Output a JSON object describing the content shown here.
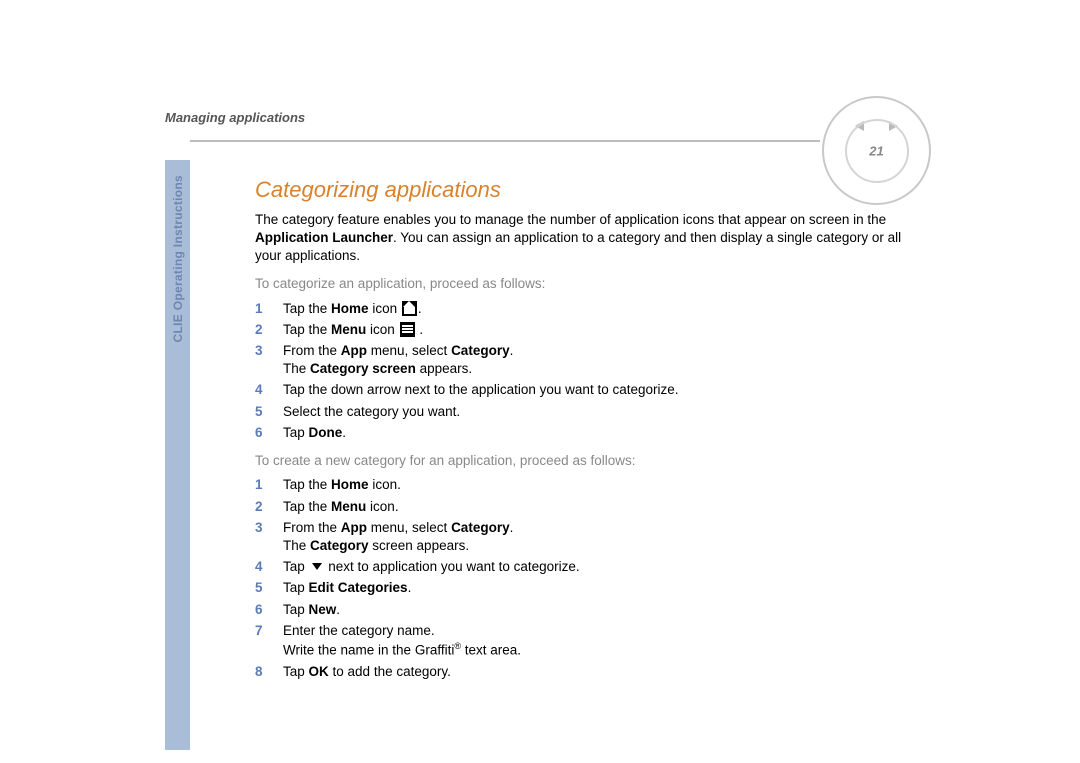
{
  "chapter": "Managing applications",
  "sidebar_label": "CLIE Operating Instructions",
  "page_number": "21",
  "title": "Categorizing applications",
  "intro_p1a": "The category feature enables you to manage the number of application icons that appear on screen in the ",
  "intro_b1": "Application Launcher",
  "intro_p1b": ". You can assign an application to a category and then display a single category or all your applications.",
  "proc1_lead": "To categorize an application, proceed as follows:",
  "s1": {
    "a": "Tap the ",
    "b": "Home",
    "c": " icon ",
    "d": "."
  },
  "s2": {
    "a": "Tap the ",
    "b": "Menu",
    "c": " icon ",
    "d": " ."
  },
  "s3": {
    "a": "From the ",
    "b": "App",
    "c": " menu, select ",
    "d": "Category",
    "e": ".",
    "f": "The ",
    "g": "Category screen",
    "h": " appears."
  },
  "s4": "Tap the down arrow next to the application you want to categorize.",
  "s5": "Select the category you want.",
  "s6": {
    "a": "Tap ",
    "b": "Done",
    "c": "."
  },
  "proc2_lead": "To create a new category for an application, proceed as follows:",
  "t1": {
    "a": "Tap the ",
    "b": "Home",
    "c": " icon."
  },
  "t2": {
    "a": "Tap the ",
    "b": "Menu",
    "c": " icon."
  },
  "t3": {
    "a": "From the ",
    "b": "App",
    "c": " menu, select ",
    "d": "Category",
    "e": ".",
    "f": "The ",
    "g": "Category",
    "h": " screen appears."
  },
  "t4": {
    "a": "Tap ",
    "b": " next to application you want to categorize."
  },
  "t5": {
    "a": "Tap ",
    "b": "Edit Categories",
    "c": "."
  },
  "t6": {
    "a": "Tap ",
    "b": "New",
    "c": "."
  },
  "t7": {
    "a": "Enter the category name.",
    "b": "Write the name in the Graffiti",
    "c": " text area."
  },
  "t8": {
    "a": "Tap ",
    "b": "OK",
    "c": " to add the category."
  }
}
